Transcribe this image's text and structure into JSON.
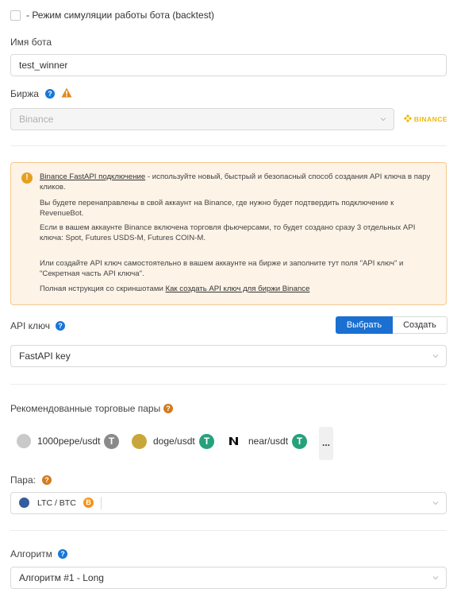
{
  "backtest": {
    "label": "- Режим симуляции работы бота (backtest)",
    "checked": false
  },
  "bot_name": {
    "label": "Имя бота",
    "value": "test_winner"
  },
  "exchange": {
    "label": "Биржа",
    "value": "Binance",
    "logo_text": "BINANCE"
  },
  "info": {
    "link1": "Binance FastAPI подключение",
    "p1_rest": " - используйте новый, быстрый и безопасный способ создания API ключа в пару кликов.",
    "p2": "Вы будете перенаправлены в свой аккаунт на Binance, где нужно будет подтвердить подключение к RevenueBot.",
    "p3": "Если в вашем аккаунте Binance включена торговля фьючерсами, то будет создано сразу 3 отдельных API ключа: Spot, Futures USDS-M, Futures COIN-M.",
    "p4": "Или создайте API ключ самостоятельно в вашем аккаунте на бирже и заполните тут поля \"API ключ\" и \"Секретная часть API ключа\".",
    "p5_pre": "Полная нструкция со скриншотами ",
    "p5_link": "Как создать API ключ для биржи Binance"
  },
  "api_key": {
    "label": "API ключ",
    "select_label": "Выбрать",
    "create_label": "Создать",
    "value": "FastAPI key"
  },
  "recommended": {
    "label": "Рекомендованные торговые пары",
    "pairs": [
      {
        "name": "1000pepe/usdt"
      },
      {
        "name": "doge/usdt"
      },
      {
        "name": "near/usdt"
      }
    ],
    "more": "..."
  },
  "pair": {
    "label": "Пара:",
    "value": "LTC / BTC"
  },
  "algorithm": {
    "label": "Алгоритм",
    "value": "Алгоритм #1 - Long"
  },
  "colors": {
    "primary": "#1a6fd1",
    "help_blue": "#1677d8",
    "help_orange": "#d47b1d",
    "warning": "#e08a1e",
    "tether": "#26a17b",
    "binance": "#f0b90b"
  }
}
